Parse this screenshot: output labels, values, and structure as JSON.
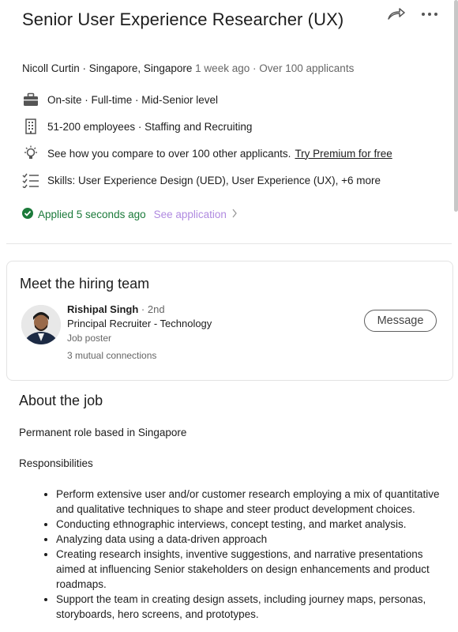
{
  "job": {
    "title": "Senior User Experience Researcher (UX)",
    "company": "Nicoll Curtin",
    "location": "Singapore, Singapore",
    "posted": "1 week ago",
    "applicants": "Over 100 applicants"
  },
  "details": {
    "workplace": "On-site · Full-time · Mid-Senior level",
    "company_size": "51-200 employees · Staffing and Recruiting",
    "compare_text": "See how you compare to over 100 other applicants.",
    "compare_link": "Try Premium for free",
    "skills": "Skills: User Experience Design (UED), User Experience (UX), +6 more"
  },
  "status": {
    "applied": "Applied 5 seconds ago",
    "see_application": "See application"
  },
  "hiring_team": {
    "heading": "Meet the hiring team",
    "name": "Rishipal Singh",
    "degree": "2nd",
    "role": "Principal Recruiter - Technology",
    "poster": "Job poster",
    "mutual": "3 mutual connections",
    "message_button": "Message"
  },
  "about": {
    "heading": "About the job",
    "intro": "Permanent role based in Singapore",
    "responsibilities_label": "Responsibilities",
    "responsibilities": [
      "Perform extensive user and/or customer research employing a mix of quantitative and qualitative techniques to shape and steer product development choices.",
      "Conducting ethnographic interviews, concept testing, and market analysis.",
      "Analyzing data using a data-driven approach",
      "Creating research insights, inventive suggestions, and narrative presentations aimed at influencing Senior stakeholders on design enhancements and product roadmaps.",
      "Support the team in creating design assets, including journey maps, personas, storyboards, hero screens, and prototypes."
    ]
  },
  "icons": [
    "share-icon",
    "more-icon",
    "briefcase-icon",
    "building-icon",
    "lightbulb-icon",
    "checklist-icon",
    "check-circle-icon",
    "chevron-right-icon"
  ],
  "colors": {
    "applied_green": "#1b7a3a",
    "see_application": "#b08ae0"
  }
}
